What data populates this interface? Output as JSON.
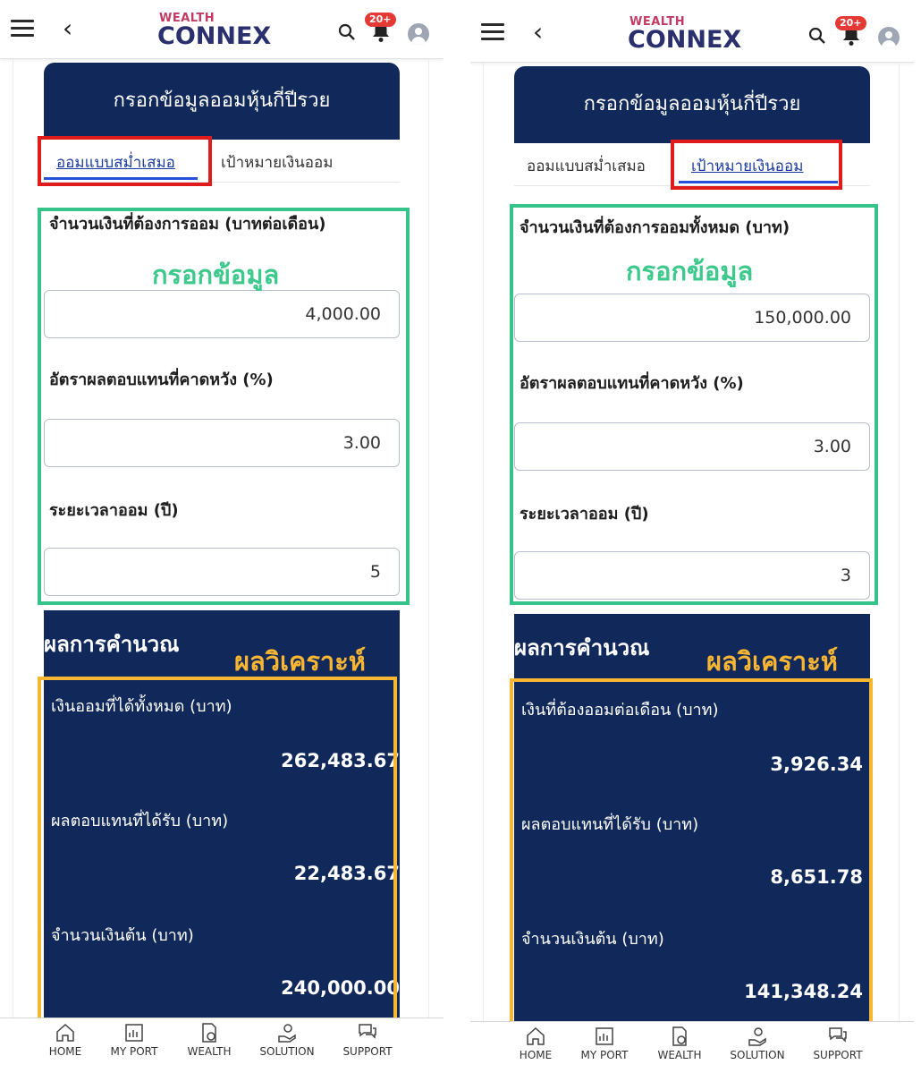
{
  "colors": {
    "navy": "#11295a",
    "tab_active": "#1a3aa0",
    "annot_red": "#e01b1b",
    "annot_green": "#35c48a",
    "annot_orange": "#f7b732"
  },
  "header": {
    "logo_small": "WEALTH",
    "logo_big_1": "CONNEX",
    "badge": "20+"
  },
  "nav": [
    "HOME",
    "MY PORT",
    "WEALTH",
    "SOLUTION",
    "SUPPORT"
  ],
  "panels": [
    {
      "title": "กรอกข้อมูลออมหุ้นกี่ปีรวย",
      "tabs": [
        "ออมแบบสม่ำเสมอ",
        "เป้าหมายเงินออม"
      ],
      "active_tab": 0,
      "annotation_input": "กรอกข้อมูล",
      "annotation_result": "ผลวิเคราะห์",
      "fields": [
        {
          "label": "จำนวนเงินที่ต้องการออม (บาทต่อเดือน)",
          "value": "4,000.00"
        },
        {
          "label": "อัตราผลตอบแทนที่คาดหวัง (%)",
          "value": "3.00"
        },
        {
          "label": "ระยะเวลาออม (ปี)",
          "value": "5"
        }
      ],
      "result_title": "ผลการคำนวณ",
      "results": [
        {
          "label": "เงินออมที่ได้ทั้งหมด (บาท)",
          "value": "262,483.67"
        },
        {
          "label": "ผลตอบแทนที่ได้รับ (บาท)",
          "value": "22,483.67"
        },
        {
          "label": "จำนวนเงินต้น (บาท)",
          "value": "240,000.00"
        }
      ]
    },
    {
      "title": "กรอกข้อมูลออมหุ้นกี่ปีรวย",
      "tabs": [
        "ออมแบบสม่ำเสมอ",
        "เป้าหมายเงินออม"
      ],
      "active_tab": 1,
      "annotation_input": "กรอกข้อมูล",
      "annotation_result": "ผลวิเคราะห์",
      "fields": [
        {
          "label": "จำนวนเงินที่ต้องการออมทั้งหมด (บาท)",
          "value": "150,000.00"
        },
        {
          "label": "อัตราผลตอบแทนที่คาดหวัง (%)",
          "value": "3.00"
        },
        {
          "label": "ระยะเวลาออม (ปี)",
          "value": "3"
        }
      ],
      "result_title": "ผลการคำนวณ",
      "results": [
        {
          "label": "เงินที่ต้องออมต่อเดือน (บาท)",
          "value": "3,926.34"
        },
        {
          "label": "ผลตอบแทนที่ได้รับ (บาท)",
          "value": "8,651.78"
        },
        {
          "label": "จำนวนเงินต้น (บาท)",
          "value": "141,348.24"
        }
      ]
    }
  ]
}
